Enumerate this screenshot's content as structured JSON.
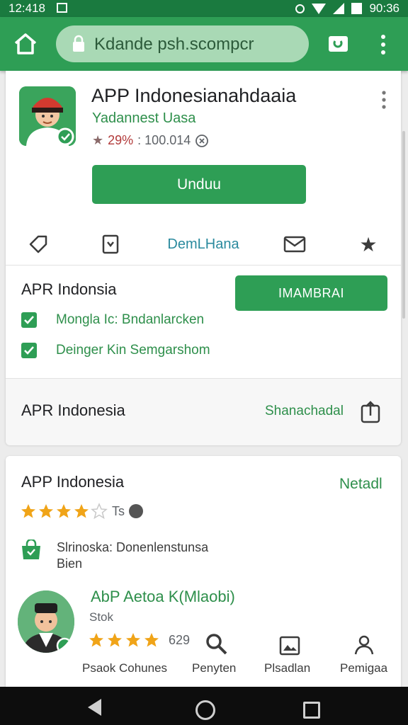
{
  "status_bar": {
    "time": "12:418",
    "clock": "90:36"
  },
  "browser": {
    "url": "Kdande psh.scompcr"
  },
  "app": {
    "title": "APP Indonesianahdaaia",
    "developer": "Yadannest Uasa",
    "rating_percent": "29%",
    "rating_count": ": 100.014",
    "install_label": "Unduu",
    "actions": [
      {
        "label": ""
      },
      {
        "label": ""
      },
      {
        "label": "DemLHana"
      },
      {
        "label": ""
      },
      {
        "label": ""
      }
    ]
  },
  "section1": {
    "title": "APR Indonsia",
    "cta_label": "IMAMBRAI",
    "checks": [
      "Mongla Ic: Bndanlarcken",
      "Deinger Kin Semgarshom"
    ],
    "share_title": "APR Indonesia",
    "share_label": "Shanachadal"
  },
  "section2": {
    "title": "APP Indonesia",
    "detail_link": "Netadl",
    "rating_text": "Ts",
    "rating_value": 4.5,
    "info_line1": "Slrinoska: Donenlenstunsa",
    "info_line2": "Bien",
    "featured": {
      "name": "AbP Aetoa K(Mlaobi)",
      "sub": "Stok",
      "rating_value": 4,
      "count": "629",
      "tabs": [
        "Psaok Cohunes",
        "Penyten",
        "Plsadlan",
        "Pemigaa"
      ]
    }
  },
  "colors": {
    "primary": "#2e9e55",
    "status_bar": "#1a7a3f",
    "star": "#f0a418",
    "link": "#2e8f4b"
  }
}
